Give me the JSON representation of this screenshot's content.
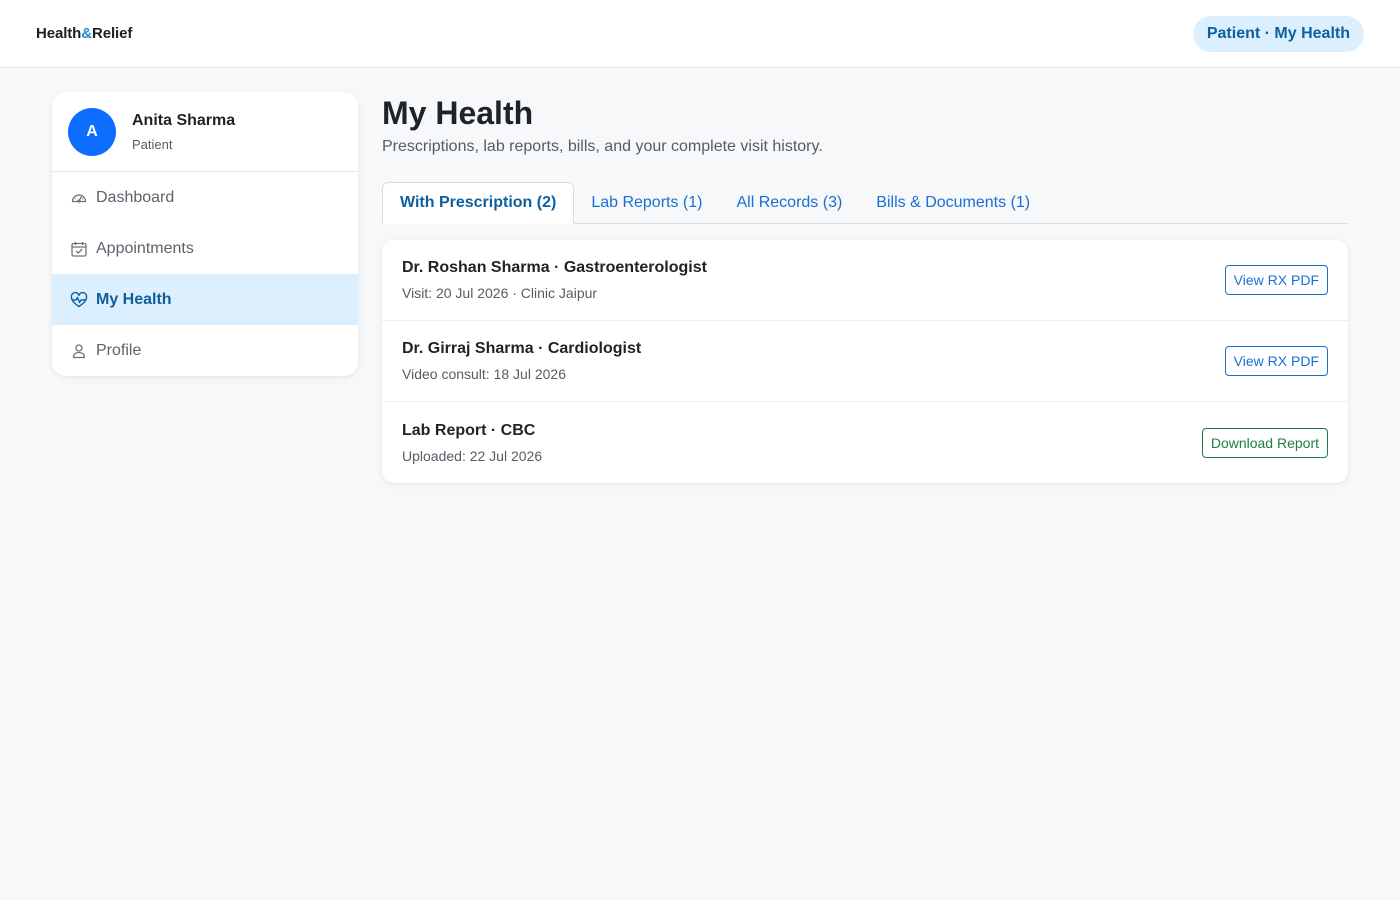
{
  "header": {
    "logo_part1": "Health",
    "logo_amp": "&",
    "logo_part2": "Relief",
    "role_badge": "Patient · My Health"
  },
  "sidebar": {
    "avatar_initial": "A",
    "user_name": "Anita Sharma",
    "user_role": "Patient",
    "items": [
      {
        "label": "Dashboard",
        "icon": "dashboard-gauge-icon",
        "active": false
      },
      {
        "label": "Appointments",
        "icon": "calendar-check-icon",
        "active": false
      },
      {
        "label": "My Health",
        "icon": "heart-pulse-icon",
        "active": true
      },
      {
        "label": "Profile",
        "icon": "person-icon",
        "active": false
      }
    ]
  },
  "main": {
    "title": "My Health",
    "subtitle": "Prescriptions, lab reports, bills, and your complete visit history.",
    "tabs": [
      {
        "label": "With Prescription (2)",
        "active": true
      },
      {
        "label": "Lab Reports (1)",
        "active": false
      },
      {
        "label": "All Records (3)",
        "active": false
      },
      {
        "label": "Bills & Documents (1)",
        "active": false
      }
    ],
    "records": [
      {
        "title": "Dr. Roshan Sharma · Gastroenterologist",
        "meta": "Visit: 20 Jul 2026 · Clinic Jaipur",
        "action": "View RX PDF"
      },
      {
        "title": "Dr. Girraj Sharma · Cardiologist",
        "meta": "Video consult: 18 Jul 2026",
        "action": "View RX PDF"
      },
      {
        "title": "Lab Report · CBC",
        "meta": "Uploaded: 22 Jul 2026",
        "action": "Download Report"
      }
    ]
  },
  "colors": {
    "accent_blue": "#0d6efd",
    "active_bg": "#dcefff",
    "active_text": "#0f5f9c",
    "link_blue": "#1a6fd1",
    "success_green": "#1e7e45",
    "page_bg": "#f6f8fa"
  }
}
